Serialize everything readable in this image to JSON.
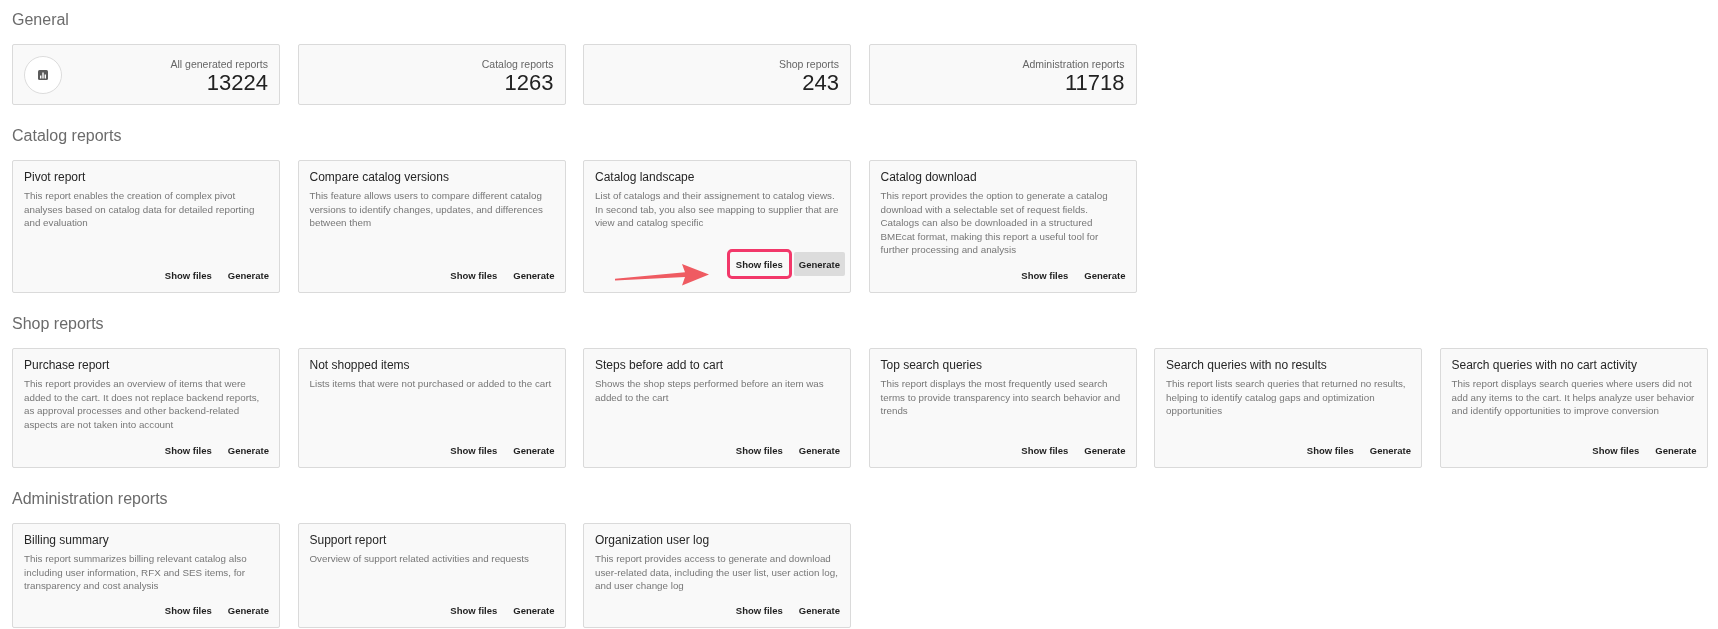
{
  "general": {
    "title": "General",
    "stats": [
      {
        "label": "All generated reports",
        "value": "13224",
        "has_icon": true
      },
      {
        "label": "Catalog reports",
        "value": "1263",
        "has_icon": false
      },
      {
        "label": "Shop reports",
        "value": "243",
        "has_icon": false
      },
      {
        "label": "Administration reports",
        "value": "11718",
        "has_icon": false
      }
    ]
  },
  "sections": [
    {
      "title": "Catalog reports",
      "cards": [
        {
          "title": "Pivot report",
          "description": "This report enables the creation of complex pivot analyses based on catalog data for detailed reporting and evaluation",
          "actions": [
            {
              "label": "Show files",
              "highlighted": false,
              "hovered": false
            },
            {
              "label": "Generate",
              "highlighted": false,
              "hovered": false
            }
          ]
        },
        {
          "title": "Compare catalog versions",
          "description": "This feature allows users to compare different catalog versions to identify changes, updates, and differences between them",
          "actions": [
            {
              "label": "Show files",
              "highlighted": false,
              "hovered": false
            },
            {
              "label": "Generate",
              "highlighted": false,
              "hovered": false
            }
          ]
        },
        {
          "title": "Catalog landscape",
          "description": "List of catalogs and their assignement to catalog views. In second tab, you also see mapping to supplier that are view and catalog specific",
          "actions": [
            {
              "label": "Show files",
              "highlighted": true,
              "hovered": false
            },
            {
              "label": "Generate",
              "highlighted": false,
              "hovered": true
            }
          ]
        },
        {
          "title": "Catalog download",
          "description": "This report provides the option to generate a catalog download with a selectable set of request fields. Catalogs can also be downloaded in a structured BMEcat format, making this report a useful tool for further processing and analysis",
          "actions": [
            {
              "label": "Show files",
              "highlighted": false,
              "hovered": false
            },
            {
              "label": "Generate",
              "highlighted": false,
              "hovered": false
            }
          ]
        }
      ]
    },
    {
      "title": "Shop reports",
      "cards": [
        {
          "title": "Purchase report",
          "description": "This report provides an overview of items that were added to the cart. It does not replace backend reports, as approval processes and other backend-related aspects are not taken into account",
          "actions": [
            {
              "label": "Show files",
              "highlighted": false,
              "hovered": false
            },
            {
              "label": "Generate",
              "highlighted": false,
              "hovered": false
            }
          ]
        },
        {
          "title": "Not shopped items",
          "description": "Lists items that were not purchased or added to the cart",
          "actions": [
            {
              "label": "Show files",
              "highlighted": false,
              "hovered": false
            },
            {
              "label": "Generate",
              "highlighted": false,
              "hovered": false
            }
          ]
        },
        {
          "title": "Steps before add to cart",
          "description": "Shows the shop steps performed before an item was added to the cart",
          "actions": [
            {
              "label": "Show files",
              "highlighted": false,
              "hovered": false
            },
            {
              "label": "Generate",
              "highlighted": false,
              "hovered": false
            }
          ]
        },
        {
          "title": "Top search queries",
          "description": "This report displays the most frequently used search terms to provide transparency into search behavior and trends",
          "actions": [
            {
              "label": "Show files",
              "highlighted": false,
              "hovered": false
            },
            {
              "label": "Generate",
              "highlighted": false,
              "hovered": false
            }
          ]
        },
        {
          "title": "Search queries with no results",
          "description": "This report lists search queries that returned no results, helping to identify catalog gaps and optimization opportunities",
          "actions": [
            {
              "label": "Show files",
              "highlighted": false,
              "hovered": false
            },
            {
              "label": "Generate",
              "highlighted": false,
              "hovered": false
            }
          ]
        },
        {
          "title": "Search queries with no cart activity",
          "description": "This report displays search queries where users did not add any items to the cart. It helps analyze user behavior and identify opportunities to improve conversion",
          "actions": [
            {
              "label": "Show files",
              "highlighted": false,
              "hovered": false
            },
            {
              "label": "Generate",
              "highlighted": false,
              "hovered": false
            }
          ]
        }
      ]
    },
    {
      "title": "Administration reports",
      "cards": [
        {
          "title": "Billing summary",
          "description": "This report summarizes billing relevant catalog also including user information, RFX and SES items, for transparency and cost analysis",
          "actions": [
            {
              "label": "Show files",
              "highlighted": false,
              "hovered": false
            },
            {
              "label": "Generate",
              "highlighted": false,
              "hovered": false
            }
          ]
        },
        {
          "title": "Support report",
          "description": "Overview of support related activities and requests",
          "actions": [
            {
              "label": "Show files",
              "highlighted": false,
              "hovered": false
            },
            {
              "label": "Generate",
              "highlighted": false,
              "hovered": false
            }
          ]
        },
        {
          "title": "Organization user log",
          "description": "This report provides access to generate and download user-related data, including the user list, user action log, and user change log",
          "actions": [
            {
              "label": "Show files",
              "highlighted": false,
              "hovered": false
            },
            {
              "label": "Generate",
              "highlighted": false,
              "hovered": false
            }
          ]
        }
      ]
    }
  ]
}
